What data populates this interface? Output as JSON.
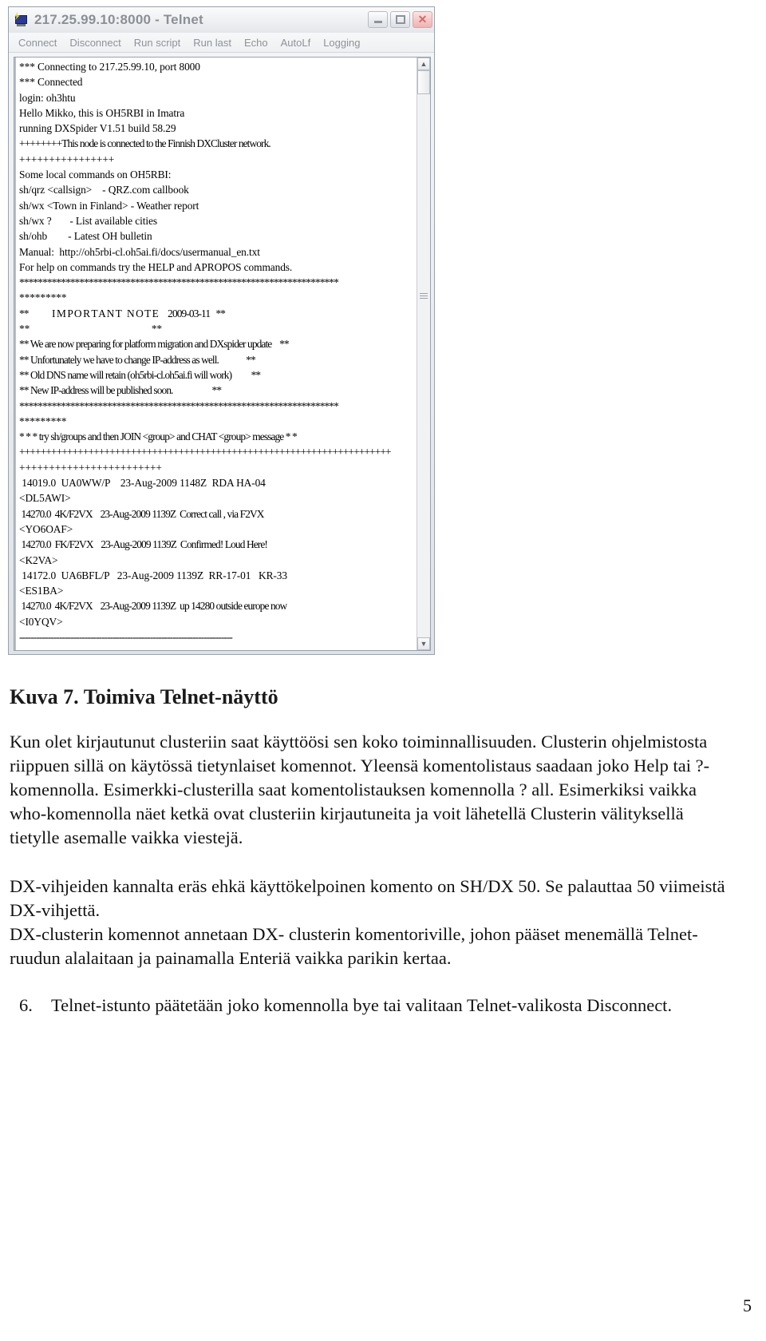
{
  "window": {
    "title": "217.25.99.10:8000 - Telnet",
    "icon": "telnet-computer-icon",
    "buttons": {
      "minimize": "minimize-button",
      "maximize": "maximize-button",
      "close_label": "✕"
    },
    "menu": [
      "Connect",
      "Disconnect",
      "Run script",
      "Run last",
      "Echo",
      "AutoLf",
      "Logging"
    ],
    "scrollbar": {
      "up_arrow": "▲",
      "down_arrow": "▼"
    }
  },
  "terminal": {
    "lines": [
      "*** Connecting to 217.25.99.10, port 8000",
      "*** Connected",
      "login: oh3htu",
      "Hello Mikko, this is OH5RBI in Imatra",
      "running DXSpider V1.51 build 58.29",
      "++++++++This node is connected to the Finnish DXCluster network.",
      "++++++++++++++++",
      "Some local commands on OH5RBI:",
      "sh/qrz <callsign>    - QRZ.com callbook",
      "sh/wx <Town in Finland> - Weather report",
      "sh/wx ?       - List available cities",
      "sh/ohb        - Latest OH bulletin",
      "Manual:  http://oh5rbi-cl.oh5ai.fi/docs/usermanual_en.txt",
      "For help on commands try the HELP and APROPOS commands.",
      "*********************************************************************",
      "*********",
      "**            I M P O R T A N T   N O T E     2009-03-11   **",
      "**                                               **",
      "** We are now preparing for platform migration and DXspider update    **",
      "** Unfortunately we have to change IP-address as well.              **",
      "** Old DNS name will retain (oh5rbi-cl.oh5ai.fi will work)          **",
      "** New IP-address will be published soon.                    **",
      "*********************************************************************",
      "*********",
      "* * * try sh/groups and then JOIN <group> and CHAT <group> message * *",
      "++++++++++++++++++++++++++++++++++++++++++++++++++++++++++++++++++++++",
      "++++++++++++++++++++++++",
      " 14019.0  UA0WW/P    23-Aug-2009 1148Z  RDA HA-04",
      "<DL5AWI>",
      " 14270.0  4K/F2VX    23-Aug-2009 1139Z  Correct call , via F2VX",
      "<YO6OAF>",
      " 14270.0  FK/F2VX    23-Aug-2009 1139Z  Confirmed! Loud Here!",
      "<K2VA>",
      " 14172.0  UA6BFL/P   23-Aug-2009 1139Z  RR-17-01   KR-33",
      "<ES1BA>",
      " 14270.0  4K/F2VX    23-Aug-2009 1139Z  up 14280 outside europe now",
      "<I0YQV>",
      "---------------------------------------------------------------------------"
    ]
  },
  "document": {
    "caption": "Kuva 7. Toimiva Telnet-näyttö",
    "paragraph_1": "Kun olet kirjautunut clusteriin saat käyttöösi sen koko toiminnallisuuden. Clusterin ohjelmistosta riippuen sillä on käytössä tietynlaiset komennot. Yleensä komentolistaus saadaan joko Help tai ?- komennolla. Esimerkki-clusterilla saat komentolistauksen komennolla ? all.  Esimerkiksi vaikka who-komennolla näet ketkä ovat clusteriin kirjautuneita ja voit lähetellä Clusterin välityksellä tietylle asemalle vaikka viestejä.",
    "paragraph_2": "DX-vihjeiden kannalta eräs ehkä käyttökelpoinen komento on SH/DX 50. Se palauttaa 50 viimeistä DX-vihjettä.",
    "paragraph_3": "DX-clusterin komennot annetaan DX- clusterin komentoriville, johon pääset menemällä Telnet-ruudun alalaitaan ja painamalla Enteriä vaikka parikin kertaa.",
    "list_item": {
      "number": "6.",
      "text": "Telnet-istunto päätetään joko komennolla bye tai valitaan Telnet-valikosta Disconnect."
    },
    "page_number": "5"
  }
}
